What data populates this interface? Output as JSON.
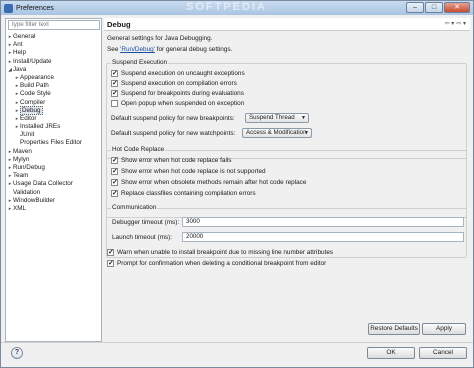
{
  "window": {
    "title": "Preferences",
    "watermark": "SOFTPEDIA"
  },
  "filter": {
    "placeholder": "type filter text"
  },
  "tree": [
    {
      "label": "General",
      "expander": "▸",
      "indent": 0
    },
    {
      "label": "Ant",
      "expander": "▸",
      "indent": 0
    },
    {
      "label": "Help",
      "expander": "▸",
      "indent": 0
    },
    {
      "label": "Install/Update",
      "expander": "▸",
      "indent": 0
    },
    {
      "label": "Java",
      "expander": "◢",
      "indent": 0
    },
    {
      "label": "Appearance",
      "expander": "▸",
      "indent": 1
    },
    {
      "label": "Build Path",
      "expander": "▸",
      "indent": 1
    },
    {
      "label": "Code Style",
      "expander": "▸",
      "indent": 1
    },
    {
      "label": "Compiler",
      "expander": "▸",
      "indent": 1
    },
    {
      "label": "Debug",
      "expander": "▸",
      "indent": 1,
      "selected": true
    },
    {
      "label": "Editor",
      "expander": "▸",
      "indent": 1
    },
    {
      "label": "Installed JREs",
      "expander": "▸",
      "indent": 1
    },
    {
      "label": "JUnit",
      "expander": "",
      "indent": 1
    },
    {
      "label": "Properties Files Editor",
      "expander": "",
      "indent": 1
    },
    {
      "label": "Maven",
      "expander": "▸",
      "indent": 0
    },
    {
      "label": "Mylyn",
      "expander": "▸",
      "indent": 0
    },
    {
      "label": "Run/Debug",
      "expander": "▸",
      "indent": 0
    },
    {
      "label": "Team",
      "expander": "▸",
      "indent": 0
    },
    {
      "label": "Usage Data Collector",
      "expander": "▸",
      "indent": 0
    },
    {
      "label": "Validation",
      "expander": "",
      "indent": 0
    },
    {
      "label": "WindowBuilder",
      "expander": "▸",
      "indent": 0
    },
    {
      "label": "XML",
      "expander": "▸",
      "indent": 0
    }
  ],
  "page": {
    "title": "Debug",
    "description": "General settings for Java Debugging.",
    "see_prefix": "See ",
    "see_link": "'Run/Debug'",
    "see_suffix": " for general debug settings."
  },
  "suspend": {
    "title": "Suspend Execution",
    "options": [
      {
        "label": "Suspend execution on uncaught exceptions",
        "checked": true
      },
      {
        "label": "Suspend execution on compilation errors",
        "checked": true
      },
      {
        "label": "Suspend for breakpoints during evaluations",
        "checked": true
      },
      {
        "label": "Open popup when suspended on exception",
        "checked": false
      }
    ],
    "breakpoints_label": "Default suspend policy for new breakpoints:",
    "breakpoints_value": "Suspend Thread",
    "watchpoints_label": "Default suspend policy for new watchpoints:",
    "watchpoints_value": "Access & Modification"
  },
  "hcr": {
    "title": "Hot Code Replace",
    "options": [
      {
        "label": "Show error when hot code replace fails",
        "checked": true
      },
      {
        "label": "Show error when hot code replace is not supported",
        "checked": true
      },
      {
        "label": "Show error when obsolete methods remain after hot code replace",
        "checked": true
      },
      {
        "label": "Replace classfiles containing compilation errors",
        "checked": true
      }
    ]
  },
  "comm": {
    "title": "Communication",
    "debugger_label": "Debugger timeout (ms):",
    "debugger_value": "3000",
    "launch_label": "Launch timeout (ms):",
    "launch_value": "20000"
  },
  "misc": [
    {
      "label": "Warn when unable to install breakpoint due to missing line number attributes",
      "checked": true
    },
    {
      "label": "Prompt for confirmation when deleting a conditional breakpoint from editor",
      "checked": true
    }
  ],
  "buttons": {
    "restore": "Restore Defaults",
    "apply": "Apply",
    "ok": "OK",
    "cancel": "Cancel",
    "help": "?"
  }
}
